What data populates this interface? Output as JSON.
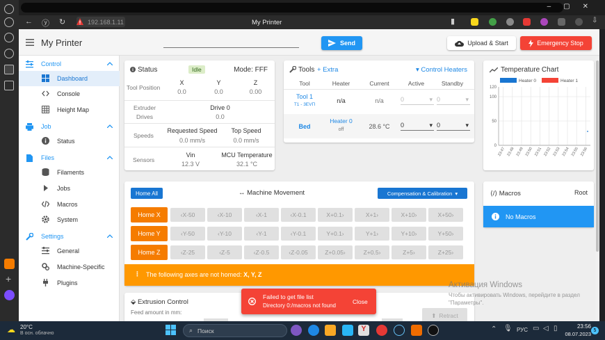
{
  "browser": {
    "url": "192.168.1.11",
    "page_title": "My Printer"
  },
  "appbar": {
    "title": "My Printer",
    "send_label": "Send",
    "upload_label": "Upload & Start",
    "estop_label": "Emergency Stop"
  },
  "sidebar": {
    "sections": [
      {
        "label": "Control",
        "items": [
          "Dashboard",
          "Console",
          "Height Map"
        ]
      },
      {
        "label": "Job",
        "items": [
          "Status"
        ]
      },
      {
        "label": "Files",
        "items": [
          "Filaments",
          "Jobs",
          "Macros",
          "System"
        ]
      },
      {
        "label": "Settings",
        "items": [
          "General",
          "Machine-Specific",
          "Plugins"
        ]
      }
    ]
  },
  "status": {
    "title": "Status",
    "state": "Idle",
    "mode": "Mode: FFF",
    "tool_position_label": "Tool Position",
    "axes": [
      {
        "name": "X",
        "value": "0.0"
      },
      {
        "name": "Y",
        "value": "0.0"
      },
      {
        "name": "Z",
        "value": "0.00"
      }
    ],
    "extruder_label": "Extruder Drives",
    "drive_name": "Drive 0",
    "drive_value": "0.0",
    "speeds_label": "Speeds",
    "requested_speed_label": "Requested Speed",
    "requested_speed": "0.0 mm/s",
    "top_speed_label": "Top Speed",
    "top_speed": "0.0 mm/s",
    "sensors_label": "Sensors",
    "vin_label": "Vin",
    "vin": "12.3 V",
    "mcu_label": "MCU Temperature",
    "mcu": "32.1 °C"
  },
  "tools": {
    "title": "Tools",
    "extra": "+ Extra",
    "control_heaters": "Control Heaters",
    "headers": [
      "Tool",
      "Heater",
      "Current",
      "Active",
      "Standby"
    ],
    "tool1_name": "Tool 1",
    "tool1_sub": "T1 - 3EVП",
    "tool1_heater": "n/a",
    "tool1_current": "n/a",
    "tool1_active": "0",
    "tool1_standby": "0",
    "bed_name": "Bed",
    "bed_heater": "Heater 0",
    "bed_heater_state": "off",
    "bed_current": "28.6 °C",
    "bed_active": "0",
    "bed_standby": "0"
  },
  "chart_data": {
    "type": "line",
    "title": "Temperature Chart",
    "legend": [
      "Heater 0",
      "Heater 1"
    ],
    "colors": [
      "#1976d2",
      "#f44336"
    ],
    "x": [
      "23:47",
      "23:48",
      "23:49",
      "23:50",
      "23:51",
      "23:52",
      "23:53",
      "23:54",
      "23:55",
      "23:56"
    ],
    "yticks": [
      "0",
      "50",
      "100",
      "120"
    ],
    "ylim": [
      0,
      120
    ],
    "series": [
      {
        "name": "Heater 0",
        "values": [
          null,
          null,
          null,
          null,
          null,
          null,
          null,
          null,
          null,
          28.6
        ]
      }
    ],
    "grid": true
  },
  "movement": {
    "home_all": "Home All",
    "title": "Machine Movement",
    "comp_label": "Compensation & Calibration",
    "rows": [
      {
        "home": "Home X",
        "jogs": [
          "X-50",
          "X-10",
          "X-1",
          "X-0.1",
          "X+0.1",
          "X+1",
          "X+10",
          "X+50"
        ]
      },
      {
        "home": "Home Y",
        "jogs": [
          "Y-50",
          "Y-10",
          "Y-1",
          "Y-0.1",
          "Y+0.1",
          "Y+1",
          "Y+10",
          "Y+50"
        ]
      },
      {
        "home": "Home Z",
        "jogs": [
          "Z-25",
          "Z-5",
          "Z-0.5",
          "Z-0.05",
          "Z+0.05",
          "Z+0.5",
          "Z+5",
          "Z+25"
        ]
      }
    ],
    "warning_prefix": "The following axes are not homed: ",
    "warning_axes": "X, Y, Z"
  },
  "macros": {
    "title": "Macros",
    "root": "Root",
    "empty": "No Macros"
  },
  "extrusion": {
    "title": "Extrusion Control",
    "feed_label": "Feed amount in mm:",
    "retract": "Retract"
  },
  "toast": {
    "title": "Failed to get file list",
    "detail": "Directory 0:/macros not found",
    "close": "Close"
  },
  "activation": {
    "title": "Активация Windows",
    "line1": "Чтобы активировать Windows, перейдите в раздел",
    "line2": "\"Параметры\"."
  },
  "taskbar": {
    "temp": "20°C",
    "weather": "В осн. облачно",
    "search": "Поиск",
    "lang": "РУС",
    "time": "23:56",
    "date": "08.07.2023",
    "notif_count": "5"
  }
}
